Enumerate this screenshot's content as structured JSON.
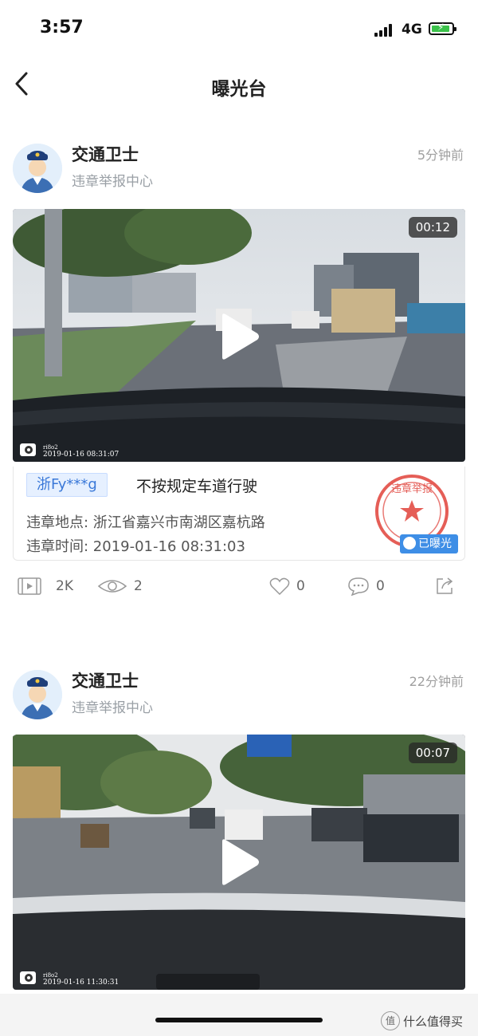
{
  "status": {
    "time": "3:57",
    "network": "4G"
  },
  "nav": {
    "title": "曝光台"
  },
  "posts": [
    {
      "author": "交通卫士",
      "subtitle": "违章举报中心",
      "time": "5分钟前",
      "video": {
        "duration": "00:12",
        "stamp": "2019-01-16 08:31:07",
        "brand": "ri8o2"
      },
      "plate": "浙Fy***g",
      "violation": "不按规定车道行驶",
      "location": "违章地点: 浙江省嘉兴市南湖区嘉杭路",
      "datetime": "违章时间: 2019-01-16 08:31:03",
      "seal_text": "违章举报",
      "badge": "已曝光",
      "stats": {
        "plays": "2K",
        "views": "2",
        "likes": "0",
        "comments": "0"
      }
    },
    {
      "author": "交通卫士",
      "subtitle": "违章举报中心",
      "time": "22分钟前",
      "video": {
        "duration": "00:07",
        "stamp": "2019-01-16 11:30:31",
        "brand": "ri8o2"
      }
    }
  ],
  "watermark": "什么值得买",
  "colors": {
    "accent": "#3e8ee6",
    "seal": "#e0423a",
    "plate_bg": "#e6f0ff"
  }
}
